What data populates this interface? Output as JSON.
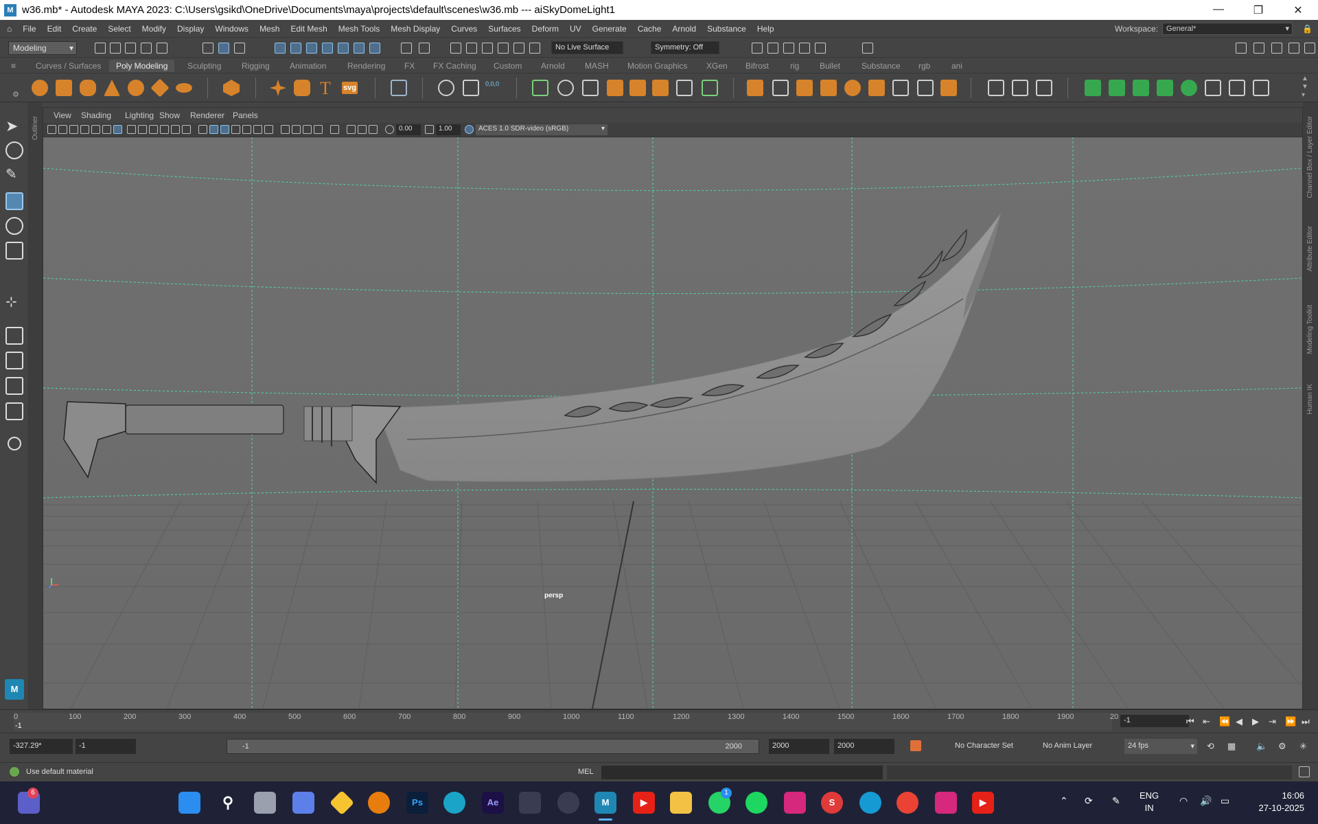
{
  "titlebar": {
    "title": "w36.mb* - Autodesk MAYA 2023: C:\\Users\\gsikd\\OneDrive\\Documents\\maya\\projects\\default\\scenes\\w36.mb   ---   aiSkyDomeLight1",
    "minimize": "—",
    "restore": "❐",
    "close": "✕"
  },
  "menubar": {
    "items": [
      "File",
      "Edit",
      "Create",
      "Select",
      "Modify",
      "Display",
      "Windows",
      "Mesh",
      "Edit Mesh",
      "Mesh Tools",
      "Mesh Display",
      "Curves",
      "Surfaces",
      "Deform",
      "UV",
      "Generate",
      "Cache",
      "Arnold",
      "Substance",
      "Help"
    ],
    "workspace_label": "Workspace:",
    "workspace_value": "General*"
  },
  "statusline": {
    "mode": "Modeling",
    "live_surface": "No Live Surface",
    "symmetry": "Symmetry: Off"
  },
  "shelf": {
    "tabs": [
      "Curves / Surfaces",
      "Poly Modeling",
      "Sculpting",
      "Rigging",
      "Animation",
      "Rendering",
      "FX",
      "FX Caching",
      "Custom",
      "Arnold",
      "MASH",
      "Motion Graphics",
      "XGen",
      "Bifrost",
      "rig",
      "Bullet",
      "Substance",
      "rgb",
      "ani"
    ],
    "active_tab": "Poly Modeling",
    "text_icon": "T",
    "svg_icon": "svg"
  },
  "outliner": {
    "label": "Outliner"
  },
  "right_panel": {
    "channel_box": "Channel Box / Layer Editor",
    "attribute_editor": "Attribute Editor",
    "modeling_toolkit": "Modeling Toolkit",
    "human_ik": "Human IK"
  },
  "viewport": {
    "menus": [
      "View",
      "Shading",
      "Lighting",
      "Show",
      "Renderer",
      "Panels"
    ],
    "exposure": "0.00",
    "gamma": "1.00",
    "colorspace": "ACES 1.0 SDR-video (sRGB)",
    "camera": "persp"
  },
  "timeslider": {
    "ticks": [
      "0",
      "100",
      "200",
      "300",
      "400",
      "500",
      "600",
      "700",
      "800",
      "900",
      "1000",
      "1100",
      "1200",
      "1300",
      "1400",
      "1500",
      "1600",
      "1700",
      "1800",
      "1900",
      "20"
    ],
    "start_label": "-1",
    "current_frame": "-1"
  },
  "rangebar": {
    "start": "-327.29*",
    "anim_start": "-1",
    "slider_start": "-1",
    "slider_end": "2000",
    "anim_end": "2000",
    "end": "2000",
    "character_set": "No Character Set",
    "anim_layer": "No Anim Layer",
    "fps": "24 fps"
  },
  "cmdline": {
    "help": "Use default material",
    "lang": "MEL"
  },
  "taskbar": {
    "lang_top": "ENG",
    "lang_bottom": "IN",
    "time": "16:06",
    "date": "27-10-2025",
    "badge_teams": "6",
    "badge_whatsapp": "1",
    "apps": [
      {
        "name": "windows-start-icon",
        "label": "",
        "color": "#2b8df0"
      },
      {
        "name": "search-icon",
        "label": "",
        "color": "transparent"
      },
      {
        "name": "task-view-icon",
        "label": "",
        "color": "#9aa0ad"
      },
      {
        "name": "copilot-icon",
        "label": "",
        "color": "#5d7fe9"
      },
      {
        "name": "sticky-icon",
        "label": "",
        "color": "#f6c431"
      },
      {
        "name": "blender-icon",
        "label": "",
        "color": "#e87d0d"
      },
      {
        "name": "photoshop-icon",
        "label": "Ps",
        "color": "#0b1e3a"
      },
      {
        "name": "edge-icon",
        "label": "",
        "color": "#1aa4c8"
      },
      {
        "name": "after-effects-icon",
        "label": "Ae",
        "color": "#1c1046"
      },
      {
        "name": "pen-icon",
        "label": "",
        "color": "#3a3d52"
      },
      {
        "name": "obs-icon",
        "label": "",
        "color": "#3a3d52"
      },
      {
        "name": "maya-icon",
        "label": "M",
        "color": "#1f87b3"
      },
      {
        "name": "youtube-icon",
        "label": "▶",
        "color": "#e62117"
      },
      {
        "name": "folder-icon",
        "label": "",
        "color": "#f3c244"
      },
      {
        "name": "whatsapp-icon",
        "label": "",
        "color": "#25d366"
      },
      {
        "name": "spotify-icon",
        "label": "",
        "color": "#1ed760"
      },
      {
        "name": "instagram-icon",
        "label": "",
        "color": "#d6287c"
      },
      {
        "name": "substance-icon",
        "label": "S",
        "color": "#e03a3a"
      },
      {
        "name": "app-icon",
        "label": "",
        "color": "#159ad4"
      },
      {
        "name": "chrome-icon",
        "label": "",
        "color": "#ea4335"
      },
      {
        "name": "instagram2-icon",
        "label": "",
        "color": "#d6287c"
      },
      {
        "name": "youtube2-icon",
        "label": "▶",
        "color": "#e62117"
      }
    ]
  }
}
